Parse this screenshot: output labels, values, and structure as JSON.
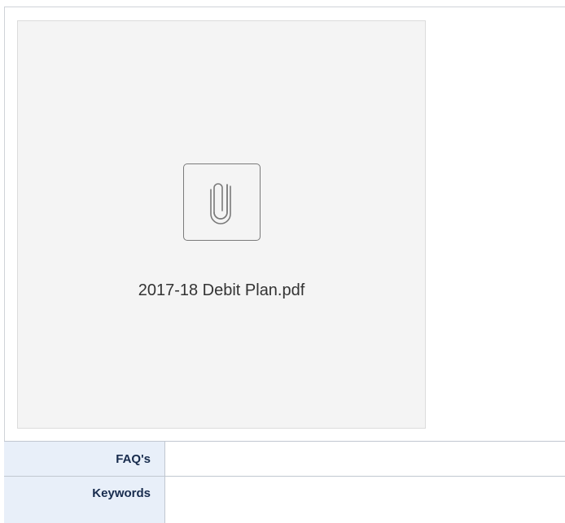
{
  "attachment": {
    "file_name": "2017-18 Debit Plan.pdf",
    "icon": "paperclip-icon"
  },
  "details_table": {
    "rows": [
      {
        "label": "FAQ's",
        "value": ""
      },
      {
        "label": "Keywords",
        "value": ""
      }
    ]
  },
  "colors": {
    "card_background": "#f4f4f4",
    "header_cell_background": "#e8eff9",
    "border": "#c1c7d0"
  }
}
